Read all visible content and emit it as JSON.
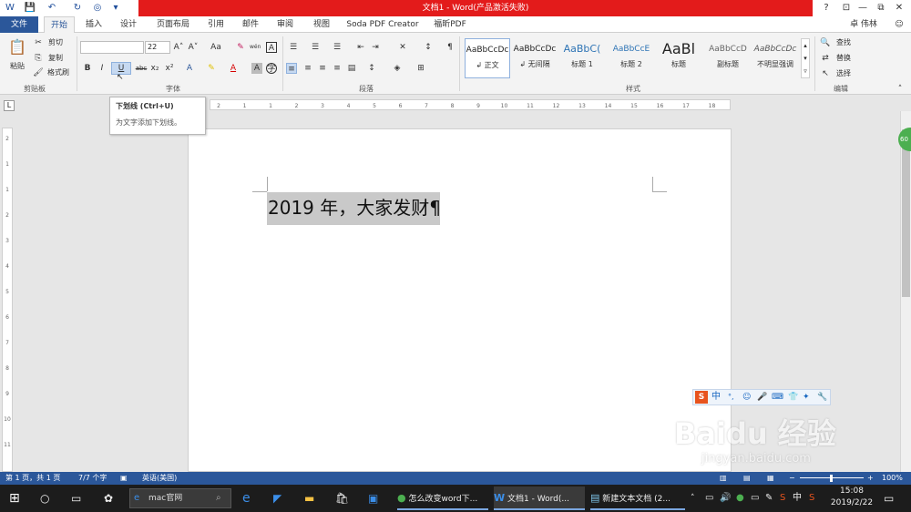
{
  "window": {
    "title": "文档1 - Word(产品激活失败)",
    "controls": {
      "help": "?",
      "restore_ribbon": "⊡",
      "minimize": "—",
      "maximize": "⧉",
      "close": "✕"
    }
  },
  "qat": {
    "icons": [
      "word-icon",
      "save-icon",
      "undo-icon",
      "redo-icon",
      "circle-icon",
      "customize-icon"
    ]
  },
  "tabs": [
    "文件",
    "开始",
    "插入",
    "设计",
    "页面布局",
    "引用",
    "邮件",
    "审阅",
    "视图",
    "Soda PDF Creator",
    "福昕PDF"
  ],
  "user": "卓 伟林",
  "clipboard": {
    "paste": "粘贴",
    "cut": "剪切",
    "copy": "复制",
    "format_painter": "格式刷",
    "label": "剪贴板"
  },
  "font": {
    "name": "",
    "size": "22",
    "bold": "B",
    "italic": "I",
    "underline": "U",
    "strike": "abc",
    "sub": "x₂",
    "sup": "x²",
    "grow": "A˄",
    "shrink": "A˅",
    "case": "Aa",
    "clear": "✎",
    "phonetic": "wén",
    "border": "A",
    "label": "字体"
  },
  "paragraph": {
    "label": "段落",
    "pilcrow": "¶"
  },
  "styles": {
    "label": "样式",
    "items": [
      {
        "preview": "AaBbCcDc",
        "name": "↲ 正文"
      },
      {
        "preview": "AaBbCcDc",
        "name": "↲ 无间隔"
      },
      {
        "preview": "AaBbC(",
        "name": "标题 1"
      },
      {
        "preview": "AaBbCcE",
        "name": "标题 2"
      },
      {
        "preview": "AaBl",
        "name": "标题"
      },
      {
        "preview": "AaBbCcD",
        "name": "副标题"
      },
      {
        "preview": "AaBbCcDc",
        "name": "不明显强调"
      }
    ]
  },
  "editing": {
    "find": "查找",
    "replace": "替换",
    "select": "选择",
    "label": "编辑"
  },
  "tooltip": {
    "title": "下划线 (Ctrl+U)",
    "desc": "为文字添加下划线。"
  },
  "ruler": {
    "ticks": [
      "2",
      "1",
      "",
      "1",
      "2",
      "4",
      "6",
      "8",
      "10",
      "12",
      "14",
      "16",
      "18",
      "",
      "20",
      "22",
      "24",
      "",
      "26",
      "28",
      "30",
      "32",
      "34",
      "36",
      "",
      "38"
    ]
  },
  "ruler_numbers": [
    "2",
    "1",
    "1",
    "2",
    "3",
    "4",
    "5",
    "6",
    "7",
    "8",
    "9",
    "10",
    "11",
    "12",
    "13",
    "14",
    "15",
    "16",
    "17",
    "18"
  ],
  "vruler_numbers": [
    "2",
    "1",
    "1",
    "2",
    "3",
    "4",
    "5",
    "6",
    "7",
    "8",
    "9",
    "10",
    "11"
  ],
  "document": {
    "text": "2019 年，大家发财",
    "pilcrow": "¶"
  },
  "ime": {
    "brand": "S",
    "lang": "中",
    "items": [
      "°,",
      "☺",
      "🎤",
      "⌨",
      "👕",
      "✦",
      "🔧"
    ]
  },
  "status": {
    "page": "第 1 页，共 1 页",
    "words": "7/7 个字",
    "lang": "英语(美国)",
    "zoom": "100%",
    "minus": "−",
    "plus": "+"
  },
  "taskbar": {
    "search_placeholder": "mac官网",
    "items": [
      "怎么改变word下...",
      "文档1 - Word(...",
      "新建文本文档 (2..."
    ],
    "ime": "中",
    "time": "15:08",
    "date": "2019/2/22"
  },
  "watermark": {
    "text": "Baidu 经验",
    "url": "jingyan.baidu.com"
  },
  "colors": {
    "accent": "#2b579a",
    "title_red": "#e31b1b",
    "selection": "#c9c9c9"
  },
  "side_badge": "60"
}
